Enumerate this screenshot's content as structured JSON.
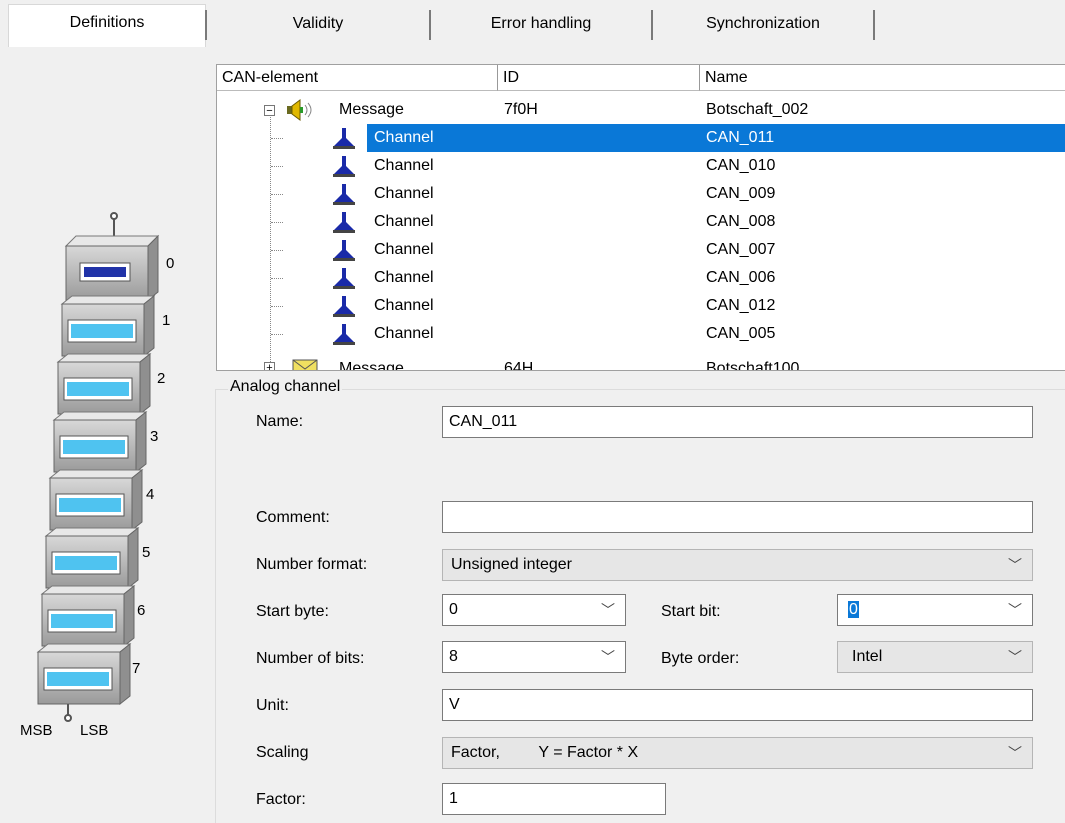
{
  "tabs": [
    {
      "label": "Definitions",
      "active": true
    },
    {
      "label": "Validity",
      "active": false
    },
    {
      "label": "Error handling",
      "active": false
    },
    {
      "label": "Synchronization",
      "active": false
    }
  ],
  "list": {
    "columns": [
      "CAN-element",
      "ID",
      "Name"
    ],
    "rows": [
      {
        "element": "Message",
        "id": "7f0H",
        "name": "Botschaft_002",
        "type": "message",
        "expanded": true
      },
      {
        "element": "Channel",
        "id": "",
        "name": "CAN_011",
        "type": "channel",
        "selected": true
      },
      {
        "element": "Channel",
        "id": "",
        "name": "CAN_010",
        "type": "channel"
      },
      {
        "element": "Channel",
        "id": "",
        "name": "CAN_009",
        "type": "channel"
      },
      {
        "element": "Channel",
        "id": "",
        "name": "CAN_008",
        "type": "channel"
      },
      {
        "element": "Channel",
        "id": "",
        "name": "CAN_007",
        "type": "channel"
      },
      {
        "element": "Channel",
        "id": "",
        "name": "CAN_006",
        "type": "channel"
      },
      {
        "element": "Channel",
        "id": "",
        "name": "CAN_012",
        "type": "channel"
      },
      {
        "element": "Channel",
        "id": "",
        "name": "CAN_005",
        "type": "channel"
      },
      {
        "element": "Message",
        "id": "64H",
        "name": "Botschaft100",
        "type": "message-envelope",
        "partial": true
      }
    ]
  },
  "form": {
    "group_title": "Analog channel",
    "name_label": "Name:",
    "name_value": "CAN_011",
    "comment_label": "Comment:",
    "comment_value": "",
    "number_format_label": "Number format:",
    "number_format_value": "Unsigned integer",
    "start_byte_label": "Start byte:",
    "start_byte_value": "0",
    "start_bit_label": "Start bit:",
    "start_bit_value": "0",
    "number_of_bits_label": "Number of bits:",
    "number_of_bits_value": "8",
    "byte_order_label": "Byte order:",
    "byte_order_value": "Intel",
    "unit_label": "Unit:",
    "unit_value": "V",
    "scaling_label": "Scaling",
    "scaling_value_a": "Factor,",
    "scaling_value_b": "Y = Factor * X",
    "factor_label": "Factor:",
    "factor_value": "1"
  },
  "byte_stack": {
    "numbers": [
      "0",
      "1",
      "2",
      "3",
      "4",
      "5",
      "6",
      "7"
    ],
    "msb": "MSB",
    "lsb": "LSB"
  },
  "colors": {
    "selection": "#0a78d7",
    "channel_icon": "#1a2aa8",
    "byte_display": "#4fc3f0"
  }
}
